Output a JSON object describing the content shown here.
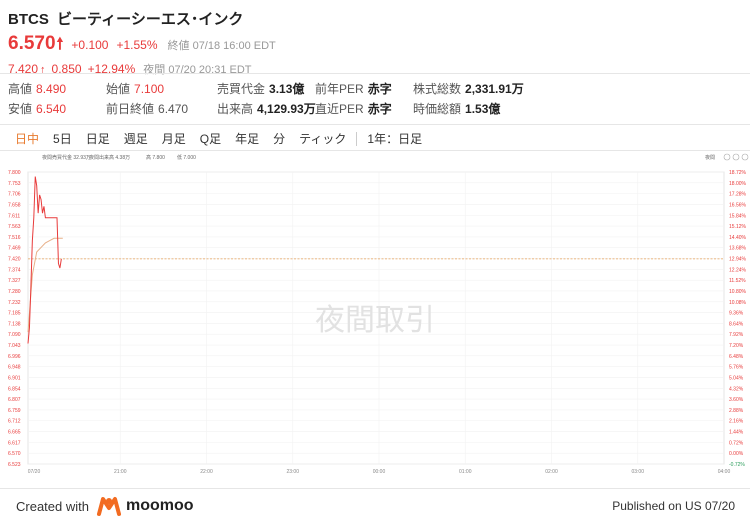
{
  "header": {
    "symbol": "BTCS",
    "name": "ビーティーシーエス･インク",
    "price": "6.570",
    "change": "+0.100",
    "change_pct": "+1.55%",
    "status": "終値 07/18 16:00 EDT",
    "night_price": "7.420",
    "night_change": "0.850",
    "night_change_pct": "+12.94%",
    "night_status": "夜間 07/20 20:31 EDT"
  },
  "stats": [
    {
      "label": "高値",
      "value": "8.490",
      "style": "red"
    },
    {
      "label": "始値",
      "value": "7.100",
      "style": "red"
    },
    {
      "label": "売買代金",
      "value": "3.13億",
      "style": "bold"
    },
    {
      "label": "前年PER",
      "value": "赤字",
      "style": "bold"
    },
    {
      "label": "株式総数",
      "value": "2,331.91万",
      "style": "bold"
    },
    {
      "label": "安値",
      "value": "6.540",
      "style": "red"
    },
    {
      "label": "前日終値",
      "value": "6.470",
      "style": "gray"
    },
    {
      "label": "出来高",
      "value": "4,129.93万",
      "style": "bold"
    },
    {
      "label": "直近PER",
      "value": "赤字",
      "style": "bold"
    },
    {
      "label": "時価総額",
      "value": "1.53億",
      "style": "bold"
    }
  ],
  "tabs": [
    "日中",
    "5日",
    "日足",
    "週足",
    "月足",
    "Q足",
    "年足",
    "分",
    "ティック"
  ],
  "tab_extra": "1年：日足",
  "chart_meta": {
    "volume_label": "夜間売買代金 32.93万",
    "sell_label": "夜間出来高 4.38万",
    "high_label": "高 7.800",
    "low_label": "低 7.000",
    "watermark": "夜間取引",
    "ctrl_label": "夜間"
  },
  "colors": {
    "up": "#e83a3a",
    "accent": "#e87a2e",
    "refline": "#e8a25a",
    "avg": "#e8b089"
  },
  "chart_data": {
    "type": "line",
    "y_left_ticks": [
      "7.800",
      "7.753",
      "7.706",
      "7.658",
      "7.611",
      "7.563",
      "7.516",
      "7.469",
      "7.420",
      "7.374",
      "7.327",
      "7.280",
      "7.232",
      "7.185",
      "7.138",
      "7.090",
      "7.043",
      "6.996",
      "6.948",
      "6.901",
      "6.854",
      "6.807",
      "6.759",
      "6.712",
      "6.665",
      "6.617",
      "6.570",
      "6.523"
    ],
    "y_right_ticks": [
      "18.72%",
      "18.00%",
      "17.28%",
      "16.56%",
      "15.84%",
      "15.12%",
      "14.40%",
      "13.68%",
      "12.94%",
      "12.24%",
      "11.52%",
      "10.80%",
      "10.08%",
      "9.36%",
      "8.64%",
      "7.92%",
      "7.20%",
      "6.48%",
      "5.76%",
      "5.04%",
      "4.32%",
      "3.60%",
      "2.88%",
      "2.16%",
      "1.44%",
      "0.72%",
      "0.00%",
      "-0.72%"
    ],
    "x_ticks": [
      "07/20",
      "21:00",
      "22:00",
      "23:00",
      "00:00",
      "01:00",
      "02:00",
      "03:00",
      "04:00"
    ],
    "ylim": [
      6.523,
      7.8
    ],
    "reference": 7.42,
    "price_series": [
      [
        0,
        7.05
      ],
      [
        1,
        7.12
      ],
      [
        2,
        7.3
      ],
      [
        3,
        7.5
      ],
      [
        4,
        7.6
      ],
      [
        5,
        7.78
      ],
      [
        6,
        7.74
      ],
      [
        7,
        7.62
      ],
      [
        8,
        7.7
      ],
      [
        9,
        7.68
      ],
      [
        10,
        7.62
      ],
      [
        11,
        7.65
      ],
      [
        12,
        7.6
      ],
      [
        13,
        7.6
      ],
      [
        14,
        7.6
      ],
      [
        15,
        7.6
      ],
      [
        16,
        7.6
      ],
      [
        17,
        7.6
      ],
      [
        18,
        7.6
      ],
      [
        19,
        7.6
      ],
      [
        20,
        7.6
      ],
      [
        21,
        7.4
      ],
      [
        22,
        7.38
      ],
      [
        23,
        7.42
      ]
    ],
    "avg_series": [
      [
        0,
        7.1
      ],
      [
        3,
        7.35
      ],
      [
        6,
        7.45
      ],
      [
        9,
        7.47
      ],
      [
        12,
        7.49
      ],
      [
        15,
        7.5
      ],
      [
        18,
        7.51
      ],
      [
        21,
        7.51
      ],
      [
        24,
        7.51
      ]
    ],
    "x_max_minutes": 480
  },
  "footer": {
    "created": "Created with",
    "brand": "moomoo",
    "published": "Published on US 07/20"
  }
}
